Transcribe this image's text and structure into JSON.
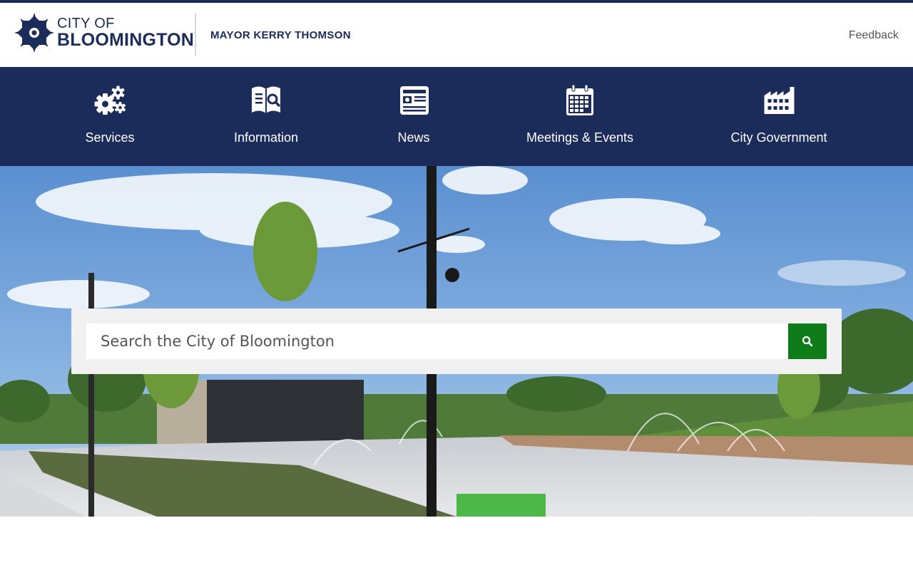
{
  "header": {
    "logo_line1": "CITY OF",
    "logo_line2": "BLOOMINGTON",
    "mayor": "MAYOR KERRY THOMSON",
    "feedback_label": "Feedback"
  },
  "nav": {
    "items": [
      {
        "label": "Services",
        "icon": "gears-icon"
      },
      {
        "label": "Information",
        "icon": "document-search-icon"
      },
      {
        "label": "News",
        "icon": "newspaper-icon"
      },
      {
        "label": "Meetings & Events",
        "icon": "calendar-icon"
      },
      {
        "label": "City Government",
        "icon": "building-icon"
      }
    ]
  },
  "search": {
    "placeholder": "Search the City of Bloomington",
    "button_icon": "search-icon"
  },
  "colors": {
    "brand_navy": "#1b2c5a",
    "search_green": "#0f7c1a",
    "panel_gray": "#f1f1f1"
  }
}
